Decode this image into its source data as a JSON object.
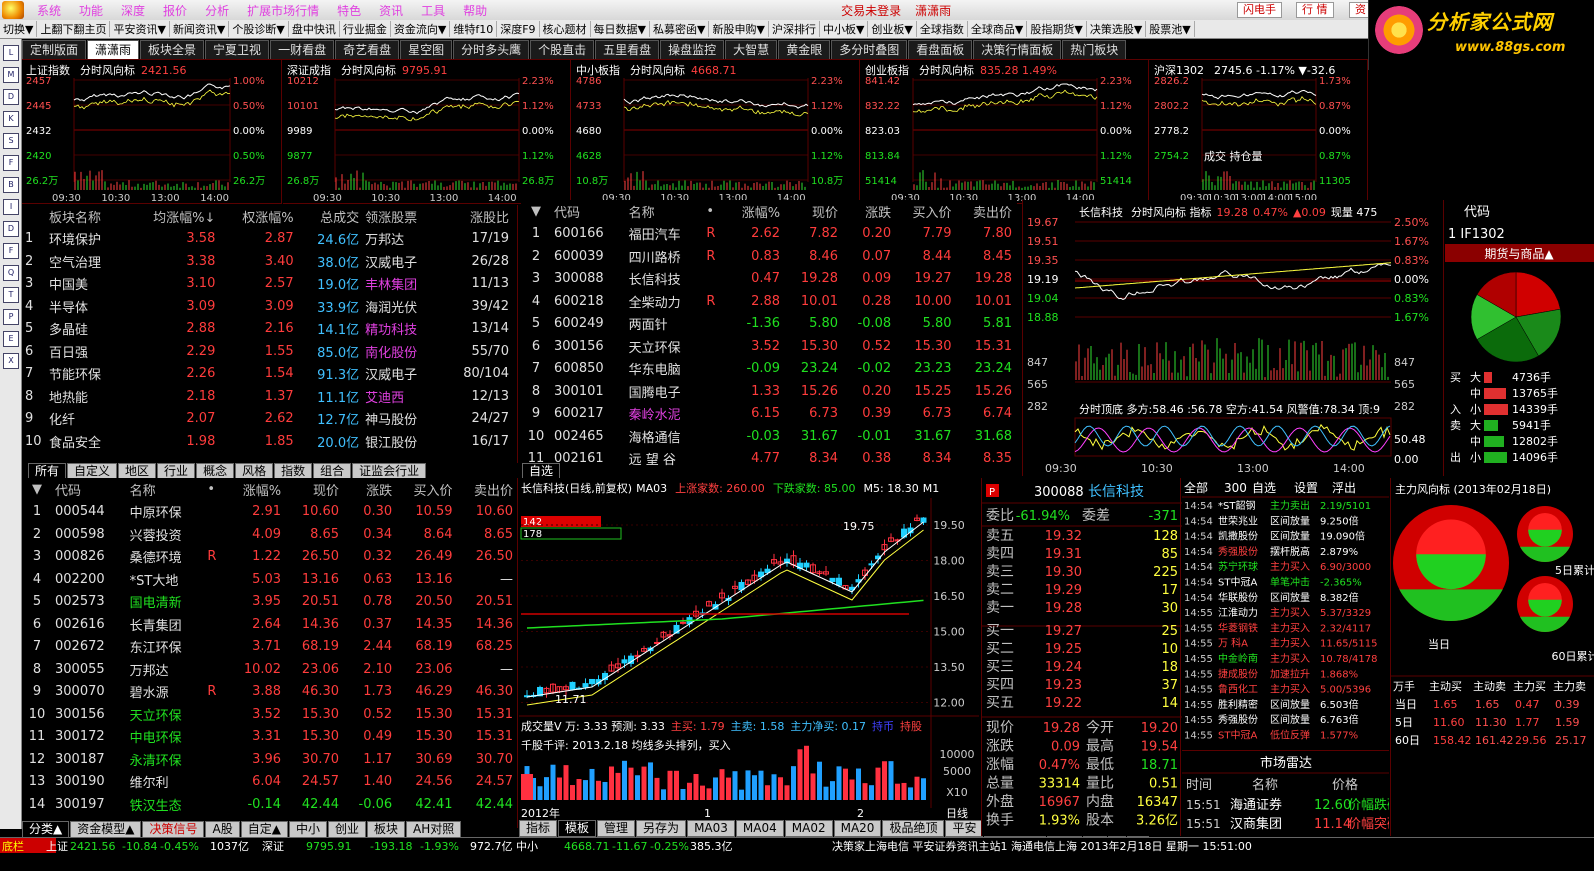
{
  "menubar": {
    "items": [
      "系统",
      "功能",
      "深度",
      "报价",
      "分析",
      "扩展市场行情",
      "特色",
      "资讯",
      "工具",
      "帮助"
    ],
    "notice": "交易未登录",
    "user": "潇潇雨",
    "btn_flash": "闪电手",
    "btn_quote": "行  情",
    "btn_info": "资"
  },
  "brand": {
    "title": "分析家公式网",
    "url": "www.88gs.com"
  },
  "toolbar": [
    "切换▼",
    "上翻下翻主页",
    "平安资讯▼",
    "新闻资讯▼",
    "个股诊断▼",
    "盘中快讯",
    "行业掘金",
    "资金流向▼",
    "维特f10",
    "深度F9",
    "核心题材",
    "每日数据▼",
    "私募密函▼",
    "新股申购▼",
    "沪深排行",
    "中小板▼",
    "创业板▼",
    "全球指数",
    "全球商品▼",
    "股指期货▼",
    "决策选股▼",
    "股票池▼"
  ],
  "tabs": [
    "定制版面",
    "潇潇雨",
    "板块全景",
    "宁夏卫视",
    "一财看盘",
    "奇艺看盘",
    "星空图",
    "分时多头鹰",
    "个股直击",
    "五里看盘",
    "操盘监控",
    "大智慧",
    "黄金眼",
    "多分时叠图",
    "看盘面板",
    "决策行情面板",
    "热门板块"
  ],
  "active_tab": "潇潇雨",
  "minis": [
    {
      "name": "上证指数",
      "sub": "分时风向标",
      "val": "2421.56",
      "left": [
        "2457",
        "2445",
        "2432",
        "2420",
        "26.2万"
      ],
      "right": [
        "1.00%",
        "0.50%",
        "0.00%",
        "0.50%",
        "26.2万"
      ],
      "times": [
        "09:30",
        "10:30",
        "13:00",
        "14:00"
      ]
    },
    {
      "name": "深证成指",
      "sub": "分时风向标",
      "val": "9795.91",
      "left": [
        "10212",
        "10101",
        "9989",
        "9877",
        "26.8万"
      ],
      "right": [
        "2.23%",
        "1.12%",
        "0.00%",
        "1.12%",
        "26.8万"
      ],
      "times": [
        "09:30",
        "10:30",
        "13:00",
        "14:00"
      ]
    },
    {
      "name": "中小板指",
      "sub": "分时风向标",
      "val": "4668.71",
      "left": [
        "4786",
        "4733",
        "4680",
        "4628",
        "10.8万"
      ],
      "right": [
        "2.23%",
        "1.12%",
        "0.00%",
        "1.12%",
        "10.8万"
      ],
      "times": [
        "09:30",
        "10:30",
        "13:00",
        "14:00"
      ]
    },
    {
      "name": "创业板指",
      "sub": "分时风向标",
      "val": "835.28 1.49%",
      "left": [
        "841.42",
        "832.22",
        "823.03",
        "813.84",
        "51414"
      ],
      "right": [
        "2.23%",
        "1.12%",
        "0.00%",
        "1.12%",
        "51414"
      ],
      "times": [
        "09:30",
        "10:30",
        "13:00",
        "14:00"
      ]
    },
    {
      "name": "沪深1302",
      "sub": "2745.6 -1.17% ▼-32.6",
      "val": "",
      "left": [
        "2826.2",
        "2802.2",
        "2778.2",
        "2754.2",
        ""
      ],
      "right": [
        "1.73%",
        "0.87%",
        "0.00%",
        "0.87%",
        "11305"
      ],
      "times": [
        "09:30",
        "10:30",
        "13:00",
        "14:00",
        "15:00"
      ],
      "extra": "成交 持仓量"
    }
  ],
  "sectors": {
    "headers": [
      "板块名称",
      "均涨幅%↓",
      "权涨幅%",
      "总成交",
      "领涨股票",
      "涨股比"
    ],
    "rows": [
      [
        "1",
        "环境保护",
        "3.58",
        "2.87",
        "24.6亿",
        "万邦达",
        "17/19"
      ],
      [
        "2",
        "空气治理",
        "3.38",
        "3.40",
        "38.0亿",
        "汉威电子",
        "26/28"
      ],
      [
        "3",
        "中国美",
        "3.10",
        "2.57",
        "19.0亿",
        "丰林集团",
        "11/13"
      ],
      [
        "4",
        "半导体",
        "3.09",
        "3.09",
        "33.9亿",
        "海润光伏",
        "39/42"
      ],
      [
        "5",
        "多晶硅",
        "2.88",
        "2.16",
        "14.1亿",
        "精功科技",
        "13/14"
      ],
      [
        "6",
        "百日强",
        "2.29",
        "1.55",
        "85.0亿",
        "南化股份",
        "55/70"
      ],
      [
        "7",
        "节能环保",
        "2.26",
        "1.54",
        "91.3亿",
        "汉威电子",
        "80/104"
      ],
      [
        "8",
        "地热能",
        "2.18",
        "1.37",
        "11.1亿",
        "艾迪西",
        "12/13"
      ],
      [
        "9",
        "化纤",
        "2.07",
        "2.62",
        "12.7亿",
        "神马股份",
        "24/27"
      ],
      [
        "10",
        "食品安全",
        "1.98",
        "1.85",
        "20.0亿",
        "银江股份",
        "16/17"
      ]
    ],
    "tabs": [
      "所有",
      "自定义",
      "地区",
      "行业",
      "概念",
      "风格",
      "指数",
      "组合",
      "证监会行业"
    ]
  },
  "watch": {
    "headers": [
      "代码",
      "名称",
      "•",
      "涨幅%",
      "现价",
      "涨跌",
      "买入价",
      "卖出价"
    ],
    "rows": [
      [
        "1",
        "600166",
        "福田汽车",
        "R",
        "2.62",
        "7.82",
        "0.20",
        "7.79",
        "7.80"
      ],
      [
        "2",
        "600039",
        "四川路桥",
        "R",
        "0.83",
        "8.46",
        "0.07",
        "8.44",
        "8.45"
      ],
      [
        "3",
        "300088",
        "长信科技",
        "",
        "0.47",
        "19.28",
        "0.09",
        "19.27",
        "19.28"
      ],
      [
        "4",
        "600218",
        "全柴动力",
        "R",
        "2.88",
        "10.01",
        "0.28",
        "10.00",
        "10.01"
      ],
      [
        "5",
        "600249",
        "两面针",
        "",
        "-1.36",
        "5.80",
        "-0.08",
        "5.80",
        "5.81"
      ],
      [
        "6",
        "300156",
        "天立环保",
        "",
        "3.52",
        "15.30",
        "0.52",
        "15.30",
        "15.31"
      ],
      [
        "7",
        "600850",
        "华东电脑",
        "",
        "-0.09",
        "23.24",
        "-0.02",
        "23.23",
        "23.24"
      ],
      [
        "8",
        "300101",
        "国腾电子",
        "",
        "1.33",
        "15.26",
        "0.20",
        "15.25",
        "15.26"
      ],
      [
        "9",
        "600217",
        "秦岭水泥",
        "",
        "6.15",
        "6.73",
        "0.39",
        "6.73",
        "6.74"
      ],
      [
        "10",
        "002465",
        "海格通信",
        "",
        "-0.03",
        "31.67",
        "-0.01",
        "31.67",
        "31.68"
      ],
      [
        "11",
        "002161",
        "远 望 谷",
        "",
        "4.77",
        "8.34",
        "0.38",
        "8.34",
        "8.35"
      ]
    ],
    "tab": "自选"
  },
  "intraday": {
    "title": "长信科技",
    "sub": "分时风向标 指标",
    "price": "19.28",
    "pct": "0.47%",
    "chg": "▲0.09",
    "vol": "现量 475",
    "left": [
      "19.67",
      "19.51",
      "19.35",
      "19.19",
      "19.04",
      "18.88",
      "847",
      "565",
      "282"
    ],
    "right": [
      "2.50%",
      "1.67%",
      "0.83%",
      "0.00%",
      "0.83%",
      "1.67%",
      "847",
      "565",
      "282"
    ],
    "ind": "分时顶底 多方:58.46 :56.78 空方:41.54 风警值:78.34 顶:9",
    "ind_right": [
      "50.48",
      "0.00"
    ],
    "times": [
      "09:30",
      "10:30",
      "13:00",
      "14:00"
    ]
  },
  "futures": {
    "code_h": "代码",
    "row": "1  IF1302",
    "title": "期货与商品▲",
    "bars": [
      {
        "side": "买",
        "lvl": "大",
        "val": "4736手"
      },
      {
        "side": "",
        "lvl": "中",
        "val": "13765手"
      },
      {
        "side": "入",
        "lvl": "小",
        "val": "14339手"
      },
      {
        "side": "卖",
        "lvl": "大",
        "val": "5941手"
      },
      {
        "side": "",
        "lvl": "中",
        "val": "12802手"
      },
      {
        "side": "出",
        "lvl": "小",
        "val": "14096手"
      }
    ]
  },
  "stocks": {
    "headers": [
      "代码",
      "名称",
      "•",
      "涨幅%",
      "现价",
      "涨跌",
      "买入价",
      "卖出价"
    ],
    "rows": [
      [
        "1",
        "000544",
        "中原环保",
        "",
        "2.91",
        "10.60",
        "0.30",
        "10.59",
        "10.60"
      ],
      [
        "2",
        "000598",
        "兴蓉投资",
        "",
        "4.09",
        "8.65",
        "0.34",
        "8.64",
        "8.65"
      ],
      [
        "3",
        "000826",
        "桑德环境",
        "R",
        "1.22",
        "26.50",
        "0.32",
        "26.49",
        "26.50"
      ],
      [
        "4",
        "002200",
        "*ST大地",
        "",
        "5.03",
        "13.16",
        "0.63",
        "13.16",
        "—"
      ],
      [
        "5",
        "002573",
        "国电清新",
        "",
        "3.95",
        "20.51",
        "0.78",
        "20.50",
        "20.51"
      ],
      [
        "6",
        "002616",
        "长青集团",
        "",
        "2.64",
        "14.36",
        "0.37",
        "14.35",
        "14.36"
      ],
      [
        "7",
        "002672",
        "东江环保",
        "",
        "3.71",
        "68.19",
        "2.44",
        "68.19",
        "68.25"
      ],
      [
        "8",
        "300055",
        "万邦达",
        "",
        "10.02",
        "23.06",
        "2.10",
        "23.06",
        "—"
      ],
      [
        "9",
        "300070",
        "碧水源",
        "R",
        "3.88",
        "46.30",
        "1.73",
        "46.29",
        "46.30"
      ],
      [
        "10",
        "300156",
        "天立环保",
        "",
        "3.52",
        "15.30",
        "0.52",
        "15.30",
        "15.31"
      ],
      [
        "11",
        "300172",
        "中电环保",
        "",
        "3.31",
        "15.30",
        "0.49",
        "15.30",
        "15.31"
      ],
      [
        "12",
        "300187",
        "永清环保",
        "",
        "3.96",
        "30.70",
        "1.17",
        "30.69",
        "30.70"
      ],
      [
        "13",
        "300190",
        "维尔利",
        "",
        "6.04",
        "24.57",
        "1.40",
        "24.56",
        "24.57"
      ],
      [
        "14",
        "300197",
        "铁汉生态",
        "",
        "-0.14",
        "42.44",
        "-0.06",
        "42.41",
        "42.44"
      ]
    ],
    "tabs": [
      "分类▲",
      "资金模型▲",
      "决策信号",
      "A股",
      "自定▲",
      "中小",
      "创业",
      "板块",
      "AH对照"
    ]
  },
  "kline": {
    "title": "长信科技(日线,前复权)",
    "ma": "MA03",
    "up": "上涨家数: 260.00",
    "down": "下跌家数: 85.00",
    "m5": "M5: 18.30",
    "m1": "M1",
    "box1": "142",
    "box2": "178",
    "peak": "19.75",
    "low": "11.71",
    "prices": [
      "19.50",
      "18.00",
      "16.50",
      "15.00",
      "13.50",
      "12.00"
    ],
    "vol_title": "成交量V 万: 3.33  预测: 3.33",
    "vol_main": "主买: 1.79",
    "vol_main2": "主卖: 1.58",
    "vol_net": "主力净买: 0.17",
    "vol_h": "持币",
    "vol_h2": "持股",
    "comment": "千股千评: 2013.2.18 均线多头排列，买入",
    "vol_axis": [
      "10000",
      "5000",
      "X10"
    ],
    "date_y": "2012年",
    "date_1": "1",
    "date_2": "2",
    "period": "日线",
    "btabs": [
      "指标",
      "模板",
      "管理",
      "另存为",
      "MA03",
      "MA04",
      "MA02",
      "MA20",
      "极品绝顶",
      "平安",
      "三线合一",
      ">>"
    ],
    "zoom": [
      "+",
      "-",
      "Z"
    ]
  },
  "quote": {
    "code": "300088",
    "name": "长信科技",
    "wb": "委比",
    "wb_v": "-61.94%",
    "wc": "委差",
    "wc_v": "-371",
    "sells": [
      [
        "卖五",
        "19.32",
        "128"
      ],
      [
        "卖四",
        "19.31",
        "85"
      ],
      [
        "卖三",
        "19.30",
        "225"
      ],
      [
        "卖二",
        "19.29",
        "17"
      ],
      [
        "卖一",
        "19.28",
        "30"
      ]
    ],
    "buys": [
      [
        "买一",
        "19.27",
        "25"
      ],
      [
        "买二",
        "19.25",
        "10"
      ],
      [
        "买三",
        "19.24",
        "18"
      ],
      [
        "买四",
        "19.23",
        "37"
      ],
      [
        "买五",
        "19.22",
        "14"
      ]
    ],
    "stats": [
      [
        "现价",
        "19.28",
        "今开",
        "19.20"
      ],
      [
        "涨跌",
        "0.09",
        "最高",
        "19.54"
      ],
      [
        "涨幅",
        "0.47%",
        "最低",
        "18.71"
      ],
      [
        "总量",
        "33314",
        "量比",
        "0.51"
      ],
      [
        "外盘",
        "16967",
        "内盘",
        "16347"
      ],
      [
        "换手",
        "1.93%",
        "股本",
        "3.26亿"
      ]
    ]
  },
  "ticks": {
    "tabs": [
      "全部",
      "300",
      "自选",
      "设置",
      "浮出"
    ],
    "rows": [
      [
        "14:54",
        "*ST韶钢",
        "主力卖出",
        "2.19/5101"
      ],
      [
        "14:54",
        "世荣兆业",
        "区间放量",
        "9.250倍"
      ],
      [
        "14:54",
        "凯撒股份",
        "区间放量",
        "19.090倍"
      ],
      [
        "14:54",
        "秀强股份",
        "摆杆脱高",
        "2.879%"
      ],
      [
        "14:54",
        "苏宁环球",
        "主力买入",
        "6.90/3000"
      ],
      [
        "14:54",
        "ST中冠A",
        "单笔冲击",
        "-2.365%"
      ],
      [
        "14:54",
        "华联股份",
        "区间放量",
        "8.382倍"
      ],
      [
        "14:55",
        "江淮动力",
        "主力买入",
        "5.37/3329"
      ],
      [
        "14:55",
        "华菱钢铁",
        "主力买入",
        "2.32/4117"
      ],
      [
        "14:55",
        "万 科A",
        "主力买入",
        "11.65/5115"
      ],
      [
        "14:55",
        "中金岭南",
        "主力买入",
        "10.78/4178"
      ],
      [
        "14:55",
        "捷成股份",
        "加速拉升",
        "1.868%"
      ],
      [
        "14:55",
        "鲁西化工",
        "主力买入",
        "5.00/5396"
      ],
      [
        "14:55",
        "胜利精密",
        "区间放量",
        "6.503倍"
      ],
      [
        "14:55",
        "秀强股份",
        "区间放量",
        "6.763倍"
      ],
      [
        "14:55",
        "ST中冠A",
        "低位反弹",
        "1.577%"
      ]
    ]
  },
  "radar": {
    "title": "市场雷达",
    "headers": [
      "时间",
      "名称",
      "价格",
      "信号"
    ],
    "rows": [
      [
        "15:51",
        "海通证券",
        "12.60",
        "价幅跌破"
      ],
      [
        "15:51",
        "汉商集团",
        "11.14",
        "价幅突破"
      ]
    ]
  },
  "flow": {
    "title": "主力风向标 (2013年02月18日)",
    "day": "当日",
    "d5": "5日累计",
    "d60": "60日累计",
    "headers": [
      "万手",
      "主动买",
      "主动卖",
      "主力买",
      "主力卖"
    ],
    "rows": [
      [
        "当日",
        "1.65",
        "1.65",
        "0.47",
        "0.39"
      ],
      [
        "5日",
        "11.60",
        "11.30",
        "1.77",
        "1.59"
      ],
      [
        "60日",
        "158.42",
        "161.42",
        "29.56",
        "25.17"
      ]
    ]
  },
  "status": {
    "items": [
      "底栏",
      "上证",
      "2421.56",
      "-10.84",
      "-0.45%",
      "1037亿",
      "深证",
      "9795.91",
      "-193.18",
      "-1.93%",
      "972.7亿",
      "中小",
      "4668.71",
      "-11.67",
      "-0.25%",
      "385.3亿"
    ],
    "news": "决策家上海电信 平安证券资讯主站1  海通电信上海  2013年2月18日 星期一 15:51:00"
  },
  "colors": {
    "up": "#ff3c3c",
    "down": "#20e020",
    "bg": "#000000",
    "grid": "#5a0000",
    "accent": "#ffff40"
  }
}
